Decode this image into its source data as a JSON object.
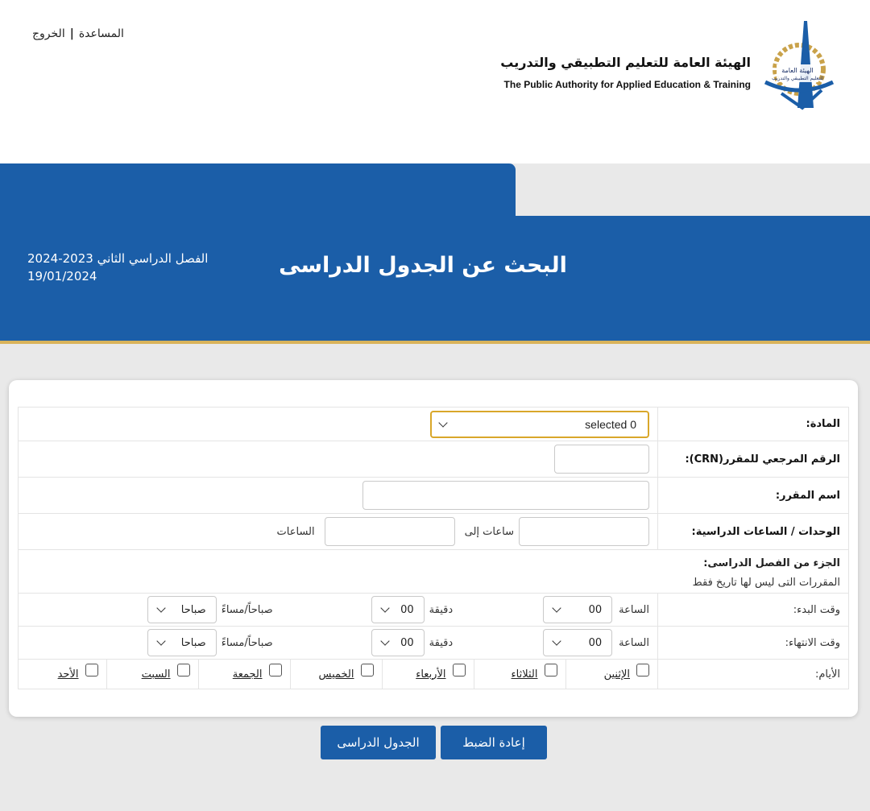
{
  "header": {
    "help_link": "المساعدة",
    "logout_link": "الخروج",
    "separator": "|",
    "org_name_ar": "الهيئة العامة للتعليم التطبيقي والتدريب",
    "org_name_en": "The Public Authority for Applied Education & Training"
  },
  "banner": {
    "title": "البحث عن الجدول الدراسى",
    "term": "الفصل الدراسي الثاني 2023-2024",
    "date": "19/01/2024"
  },
  "form": {
    "subject_label": "المادة:",
    "subject_value": "selected 0",
    "crn_label": "الرقم المرجعي للمقرر(CRN):",
    "course_name_label": "اسم المقرر:",
    "units_label": "الوحدات / الساعات الدراسية:",
    "hours_to": "ساعات إلى",
    "hours": "الساعات",
    "part_label": "الجزء من الفصل الدراسى:",
    "part_note": "المقررات التى ليس لها تاريخ فقط",
    "start_label": "وقت البدء:",
    "end_label": "وقت الانتهاء:",
    "hour_label": "الساعة",
    "minute_label": "دقيقة",
    "ampm_label": "صباحاً/مساءً",
    "hour_value": "00",
    "minute_value": "00",
    "ampm_value": "صباحا",
    "days_label": "الأيام:",
    "days": [
      "الإثنين",
      "الثلاثاء",
      "الأربعاء",
      "الخميس",
      "الجمعة",
      "السبت",
      "الأحد"
    ]
  },
  "buttons": {
    "reset": "إعادة الضبط",
    "schedule": "الجدول الدراسى"
  },
  "colors": {
    "primary_blue": "#1b5ea8",
    "gold_accent": "#d9b35a",
    "select_focus": "#d9a72a"
  },
  "icons": {
    "logo": "paae-logo",
    "dropdown": "chevron-down-icon"
  }
}
